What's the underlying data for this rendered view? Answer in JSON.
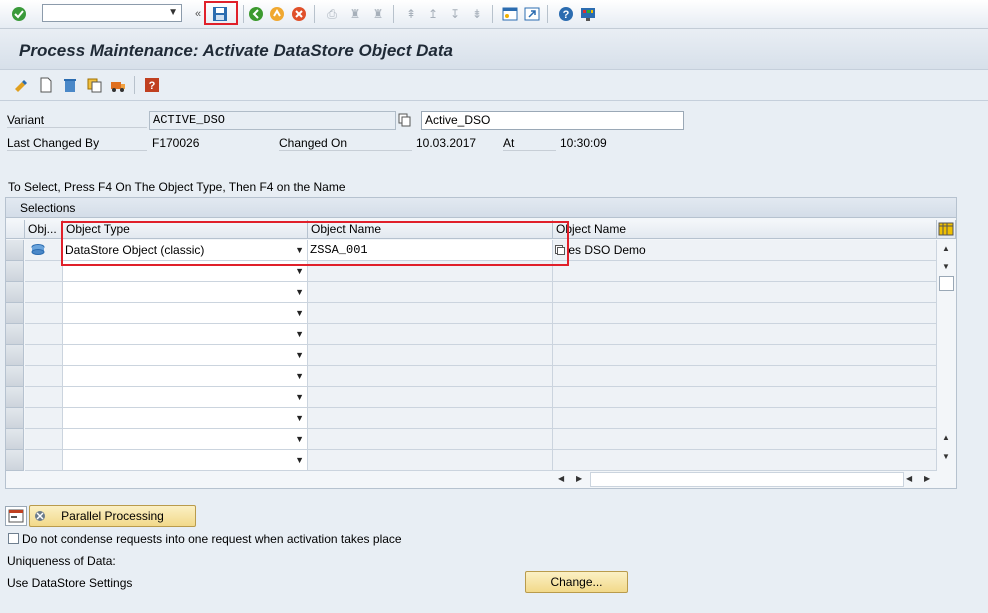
{
  "system_toolbar": {
    "icons": [
      "enter-icon",
      "save-icon",
      "back-icon",
      "exit-icon",
      "cancel-icon",
      "print-icon",
      "find-icon",
      "find-next-icon",
      "first-page-icon",
      "prev-page-icon",
      "next-page-icon",
      "last-page-icon",
      "create-session-icon",
      "shortcut-icon",
      "help-icon",
      "customize-layout-icon"
    ]
  },
  "title": "Process Maintenance: Activate DataStore Object Data",
  "app_toolbar": {
    "icons": [
      "change-display-icon",
      "create-icon",
      "delete-icon",
      "copy-icon",
      "transport-icon",
      "info-icon"
    ]
  },
  "header": {
    "variant_label": "Variant",
    "variant_value": "ACTIVE_DSO",
    "variant_desc": "Active_DSO",
    "last_changed_by_label": "Last Changed By",
    "last_changed_by_value": "F170026",
    "changed_on_label": "Changed On",
    "changed_on_value": "10.03.2017",
    "at_label": "At",
    "at_value": "10:30:09"
  },
  "instruction": "To Select, Press F4 On The Object Type, Then F4 on the Name",
  "table": {
    "caption": "Selections",
    "columns": [
      "Obj...",
      "Object Type",
      "Object Name",
      "Object Name"
    ],
    "rows": [
      {
        "object_type": "DataStore Object (classic)",
        "object_name": "ZSSA_001",
        "object_desc": "es DSO Demo"
      }
    ]
  },
  "parallel_button": "Parallel Processing",
  "checkbox_label": "Do not condense requests into one request when activation takes place",
  "uniqueness_label": "Uniqueness of Data:",
  "datastore_settings_label": "Use DataStore Settings",
  "change_button": "Change..."
}
